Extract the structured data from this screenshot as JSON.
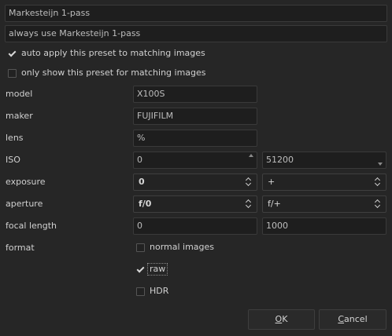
{
  "preset": {
    "name": "Markesteijn 1-pass",
    "description": "always use Markesteijn 1-pass",
    "auto_apply_label": "auto apply this preset to matching images",
    "auto_apply_checked": true,
    "only_show_label": "only show this preset for matching images",
    "only_show_checked": false
  },
  "rows": {
    "model": {
      "label": "model",
      "value": "X100S"
    },
    "maker": {
      "label": "maker",
      "value": "FUJIFILM"
    },
    "lens": {
      "label": "lens",
      "value": "%"
    },
    "iso": {
      "label": "ISO",
      "min": "0",
      "max": "51200"
    },
    "exposure": {
      "label": "exposure",
      "min": "0",
      "max": "+"
    },
    "aperture": {
      "label": "aperture",
      "min": "f/0",
      "max": "f/+"
    },
    "focal_length": {
      "label": "focal length",
      "min": "0",
      "max": "1000"
    },
    "format": {
      "label": "format",
      "normal_label": "normal images",
      "normal_checked": false,
      "raw_label": "raw",
      "raw_checked": true,
      "hdr_label": "HDR",
      "hdr_checked": false
    }
  },
  "buttons": {
    "ok_mnemonic": "O",
    "ok_rest": "K",
    "cancel_mnemonic": "C",
    "cancel_rest": "ancel"
  }
}
